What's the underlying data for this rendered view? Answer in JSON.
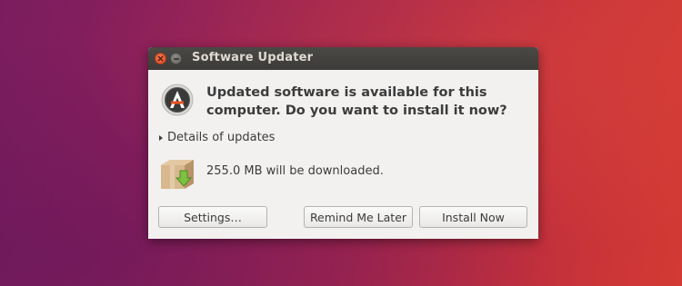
{
  "window": {
    "title": "Software Updater"
  },
  "message": {
    "headline": "Updated software is available for this computer. Do you want to install it now?",
    "details_label": "Details of updates",
    "download_size": "255.0 MB will be downloaded."
  },
  "buttons": {
    "settings_label": "Settings…",
    "remind_label": "Remind Me Later",
    "install_label": "Install Now"
  },
  "icons": {
    "app": "software-updater-icon",
    "package": "package-download-icon",
    "close": "close-icon",
    "minimize": "minimize-icon",
    "disclosure": "disclosure-triangle-icon"
  },
  "colors": {
    "titlebar": "#3c3b37",
    "close_button": "#df4a1f",
    "dialog_bg": "#f2f1f0",
    "download_arrow": "#7cc242"
  }
}
